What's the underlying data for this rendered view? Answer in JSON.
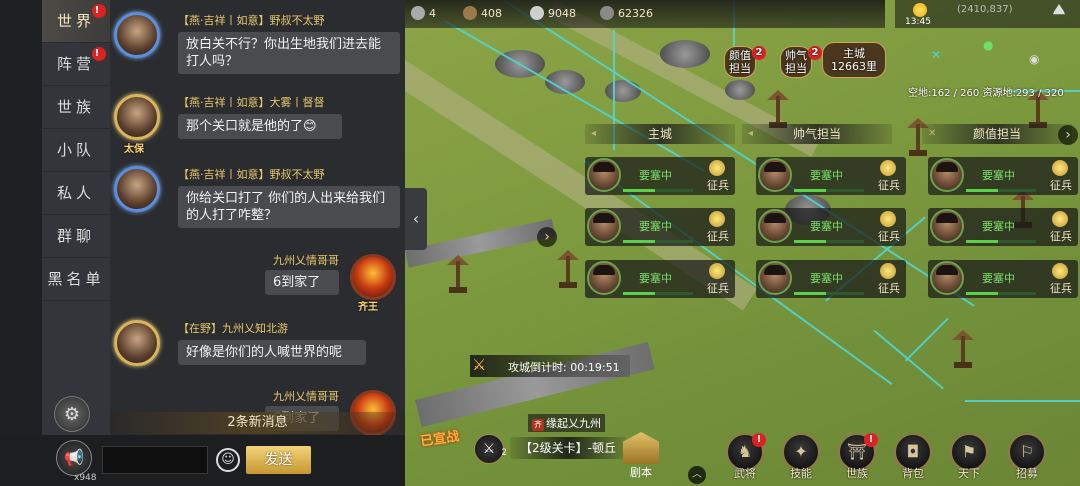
{
  "topbar": {
    "resources": [
      {
        "icon": "fist-icon",
        "value": "4"
      },
      {
        "icon": "timber-icon",
        "value": "408"
      },
      {
        "icon": "iron-icon",
        "value": "9048"
      },
      {
        "icon": "stone-icon",
        "value": "62326"
      }
    ],
    "time": "13:45",
    "coordinates": "(2410,837)",
    "land_stats": "空地:162 / 260  资源地:293 / 320"
  },
  "map": {
    "markers": [
      {
        "name": "颜值",
        "sub": "担当",
        "badge": "2"
      },
      {
        "name": "帅气",
        "sub": "担当",
        "badge": "2"
      },
      {
        "name": "主城",
        "sub": "12663里"
      }
    ],
    "groups": [
      "主城",
      "帅气担当",
      "颜值担当"
    ],
    "troops": [
      {
        "status": "要塞中",
        "recruit": "征兵",
        "hp": 0.45
      },
      {
        "status": "要塞中",
        "recruit": "征兵",
        "hp": 0.45
      },
      {
        "status": "要塞中",
        "recruit": "征兵",
        "hp": 0.45
      },
      {
        "status": "要塞中",
        "recruit": "征兵",
        "hp": 0.45
      },
      {
        "status": "要塞中",
        "recruit": "征兵",
        "hp": 0.45
      },
      {
        "status": "要塞中",
        "recruit": "征兵",
        "hp": 0.45
      },
      {
        "status": "要塞中",
        "recruit": "征兵",
        "hp": 0.45
      },
      {
        "status": "要塞中",
        "recruit": "征兵",
        "hp": 0.45
      },
      {
        "status": "要塞中",
        "recruit": "征兵",
        "hp": 0.45
      }
    ],
    "siege_label": "攻城倒计时: 00:19:51",
    "alliance_flag": "齐",
    "alliance_name": "缘起乂九州",
    "pass_name": "【2级关卡】-顿丘",
    "captured": "已宣战",
    "cross_count": "2"
  },
  "bottom_nav": {
    "script": "剧本",
    "items": [
      {
        "label": "武将",
        "icon": "general-icon",
        "badge": "!"
      },
      {
        "label": "技能",
        "icon": "skill-icon"
      },
      {
        "label": "世族",
        "icon": "clan-icon",
        "badge": "!"
      },
      {
        "label": "背包",
        "icon": "bag-icon"
      },
      {
        "label": "天下",
        "icon": "world-icon"
      },
      {
        "label": "招募",
        "icon": "recruit-icon"
      }
    ]
  },
  "chat": {
    "tabs": [
      {
        "label": "世界",
        "active": true,
        "badge": "!"
      },
      {
        "label": "阵营",
        "badge": "!"
      },
      {
        "label": "世族"
      },
      {
        "label": "小队"
      },
      {
        "label": "私人"
      },
      {
        "label": "群聊"
      },
      {
        "label": "黑名单"
      }
    ],
    "messages": [
      {
        "side": "left",
        "name": "【燕·吉祥丨如意】野叔不太野",
        "text": "放白关不行？你出生地我们进去能打人吗？"
      },
      {
        "side": "left",
        "name": "【燕·吉祥丨如意】大雾丨督督",
        "text": "那个关口就是他的了😊",
        "tag": "太保"
      },
      {
        "side": "left",
        "name": "【燕·吉祥丨如意】野叔不太野",
        "text": "你给关口打了 你们的人出来给我们的人打了咋整？"
      },
      {
        "side": "right",
        "name": "九州乂情哥哥",
        "text": "6到家了",
        "tag": "齐王"
      },
      {
        "side": "left",
        "name": "【在野】九州乂知北游",
        "text": "好像是你们的人喊世界的呢"
      },
      {
        "side": "right",
        "name": "九州乂情哥哥",
        "text": "6到家了"
      }
    ],
    "new_messages": "2条新消息",
    "horn_count": "x948",
    "input_value": "",
    "send_label": "发送"
  }
}
